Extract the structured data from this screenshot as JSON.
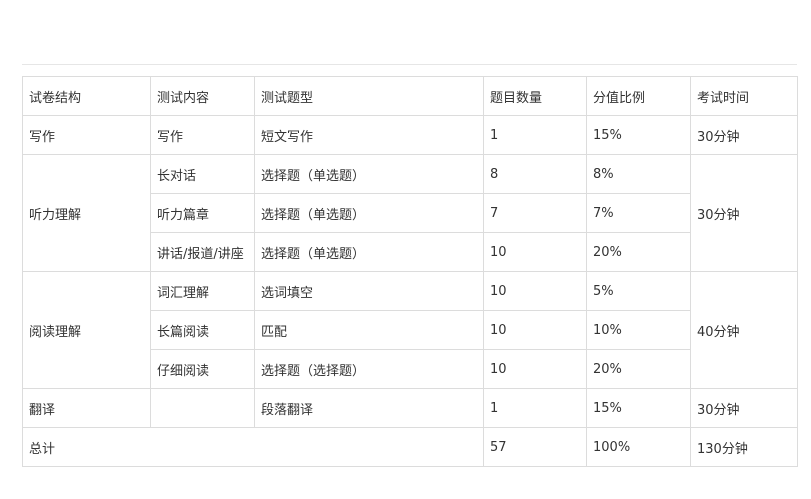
{
  "table": {
    "headers": [
      "试卷结构",
      "测试内容",
      "测试题型",
      "题目数量",
      "分值比例",
      "考试时间"
    ],
    "rows": {
      "writing": {
        "section": "写作",
        "content": "写作",
        "type": "短文写作",
        "count": "1",
        "ratio": "15%",
        "time": "30分钟"
      },
      "listening": {
        "section": "听力理解",
        "time": "30分钟",
        "items": [
          {
            "content": "长对话",
            "type": "选择题（单选题）",
            "count": "8",
            "ratio": "8%"
          },
          {
            "content": "听力篇章",
            "type": "选择题（单选题）",
            "count": "7",
            "ratio": "7%"
          },
          {
            "content": "讲话/报道/讲座",
            "type": "选择题（单选题）",
            "count": "10",
            "ratio": "20%"
          }
        ]
      },
      "reading": {
        "section": "阅读理解",
        "time": "40分钟",
        "items": [
          {
            "content": "词汇理解",
            "type": "选词填空",
            "count": "10",
            "ratio": "5%"
          },
          {
            "content": "长篇阅读",
            "type": "匹配",
            "count": "10",
            "ratio": "10%"
          },
          {
            "content": "仔细阅读",
            "type": "选择题（选择题）",
            "count": "10",
            "ratio": "20%"
          }
        ]
      },
      "translation": {
        "section": "翻译",
        "content": "",
        "type": "段落翻译",
        "count": "1",
        "ratio": "15%",
        "time": "30分钟"
      },
      "total": {
        "label": "总计",
        "count": "57",
        "ratio": "100%",
        "time": "130分钟"
      }
    }
  },
  "colors": {
    "border": "#dcdcdc",
    "text": "#333333",
    "rule": "#e6e6e6"
  }
}
